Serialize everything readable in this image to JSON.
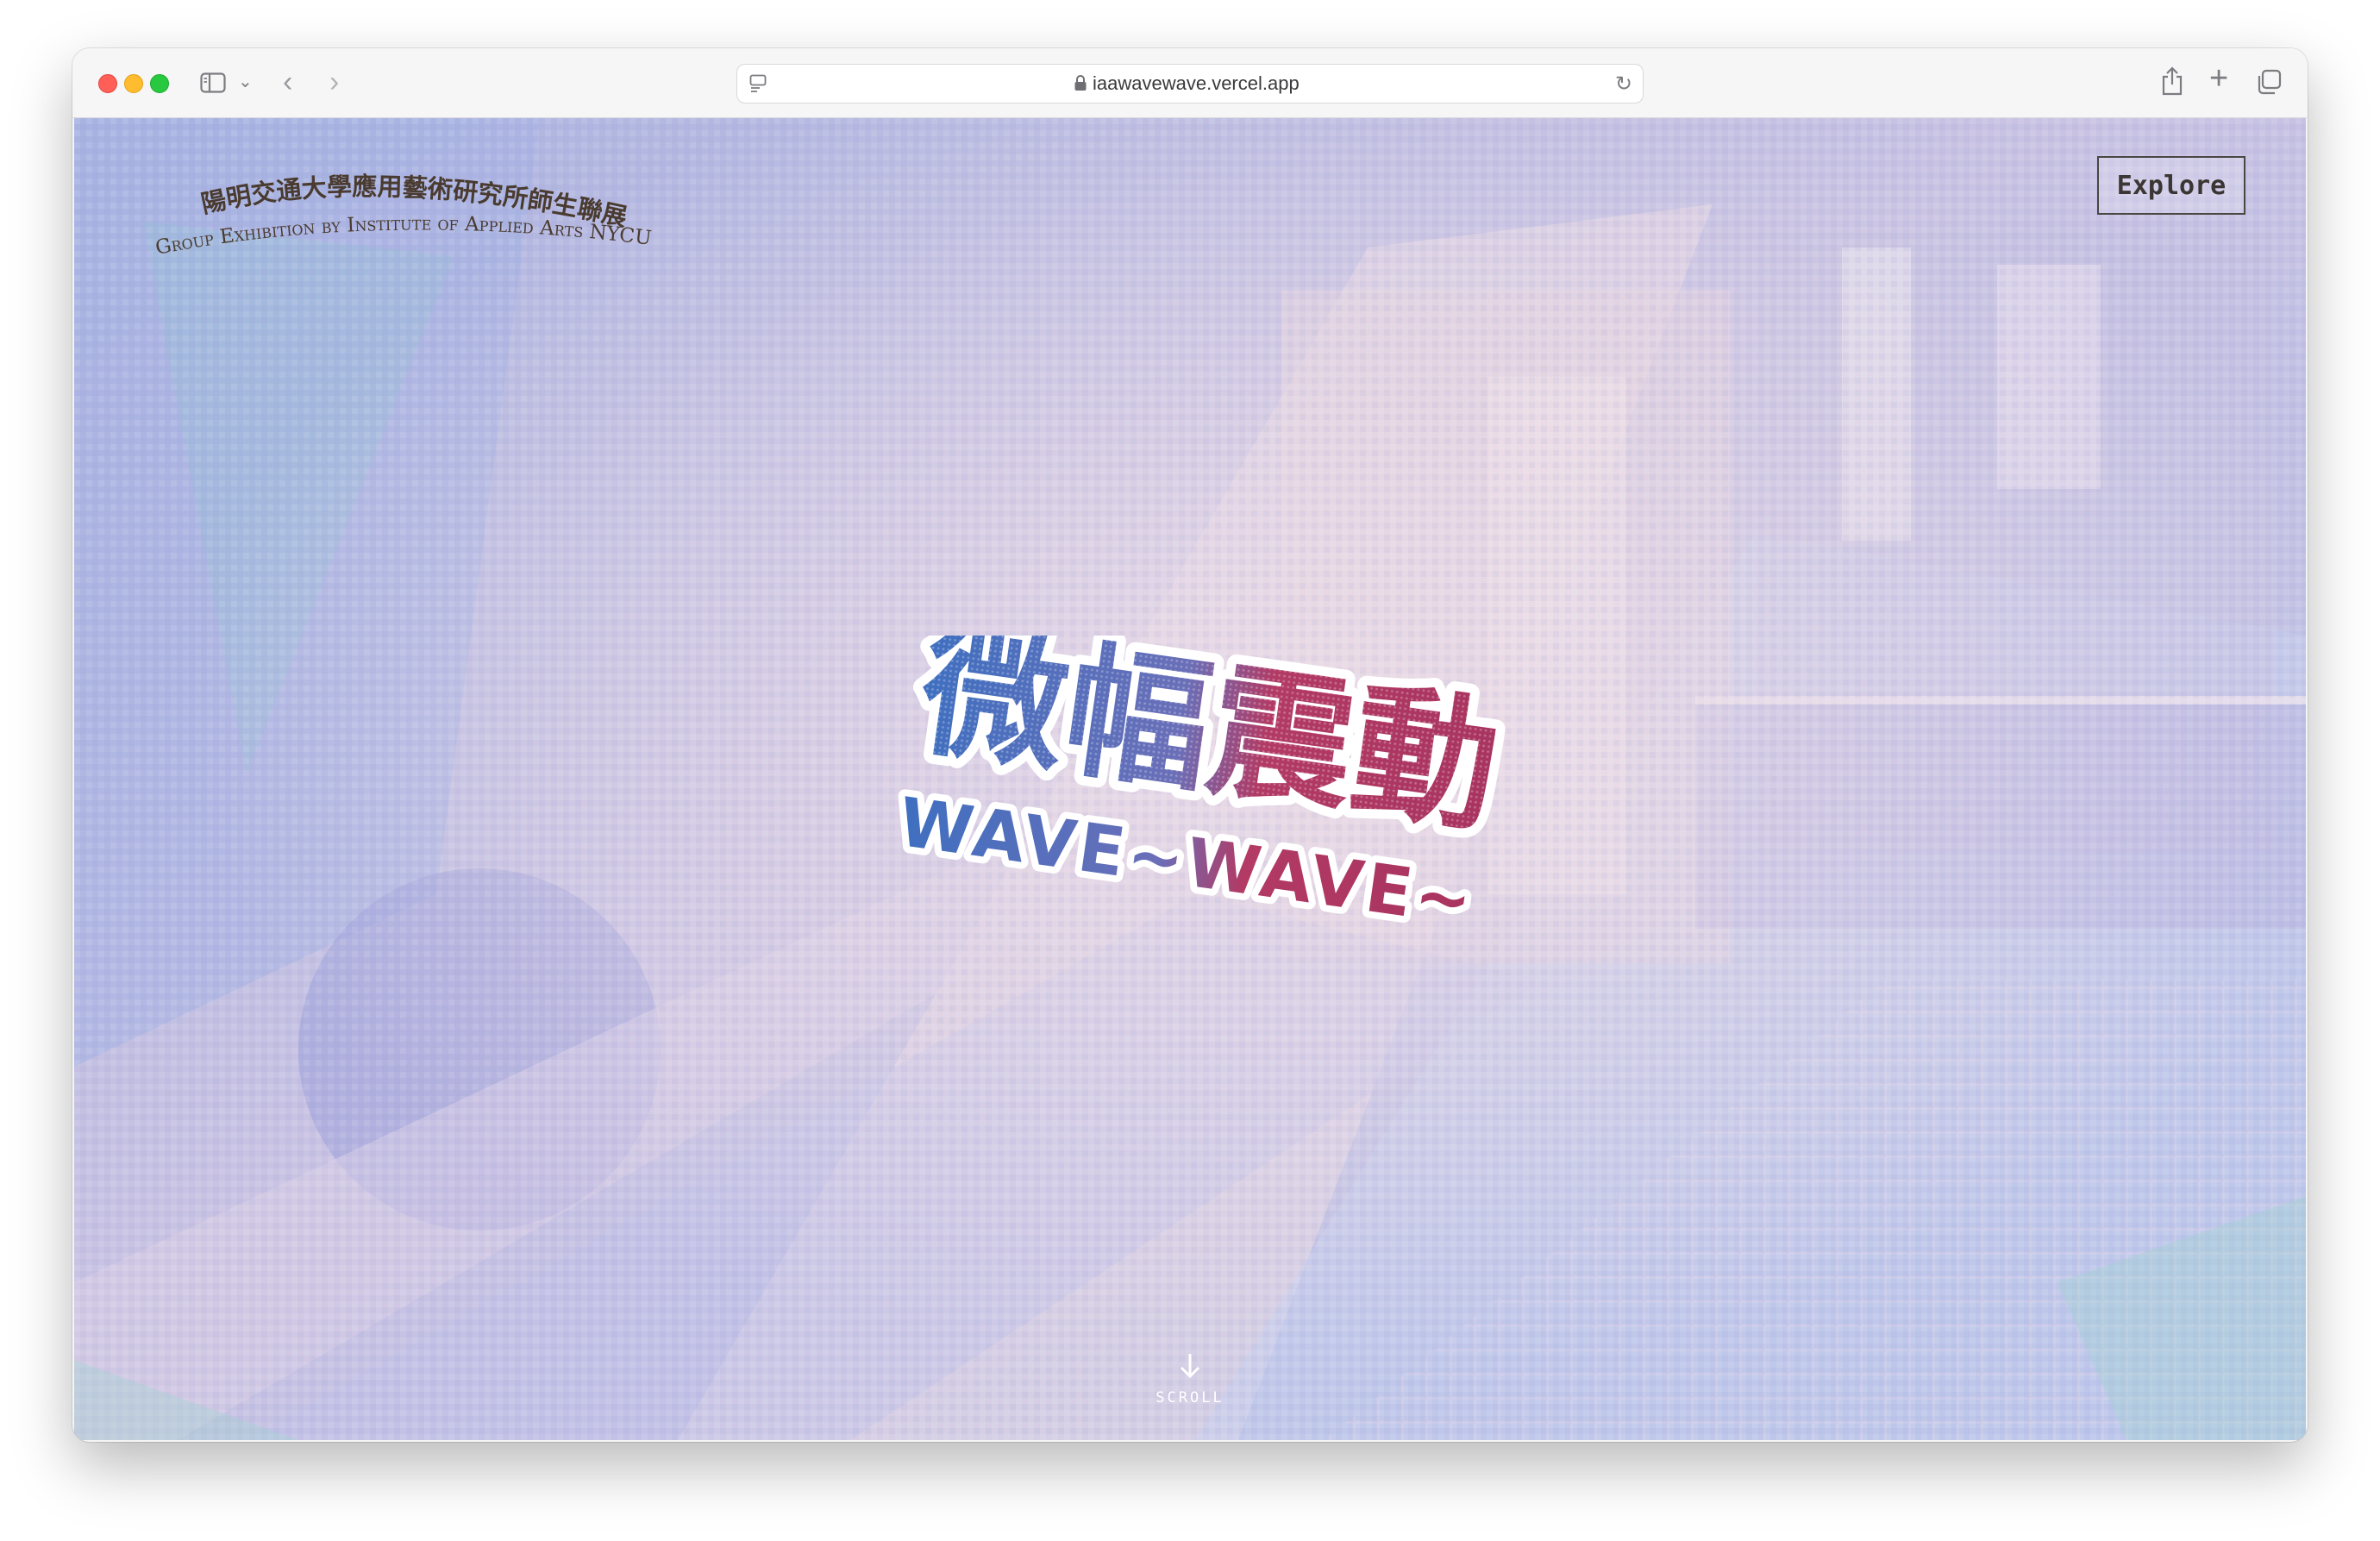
{
  "browser": {
    "url": "iaawavewave.vercel.app",
    "icons": [
      "sidebar-icon",
      "chevron-down-icon",
      "back-icon",
      "forward-icon",
      "page-icon",
      "lock-icon",
      "reload-icon",
      "share-icon",
      "plus-icon",
      "tabs-icon"
    ]
  },
  "header": {
    "org_chinese": "陽明交通大學應用藝術研究所師生聯展",
    "org_english": "Group Exhibition by Institute of Applied Arts NYCU",
    "explore_label": "Explore"
  },
  "hero": {
    "title_chinese": "微幅震動",
    "title_english": "WAVE~WAVE~",
    "colors": {
      "blue": "#3f6fc0",
      "red": "#b23a64"
    }
  },
  "scroll": {
    "label": "SCROLL",
    "icon": "arrow-down-icon"
  }
}
